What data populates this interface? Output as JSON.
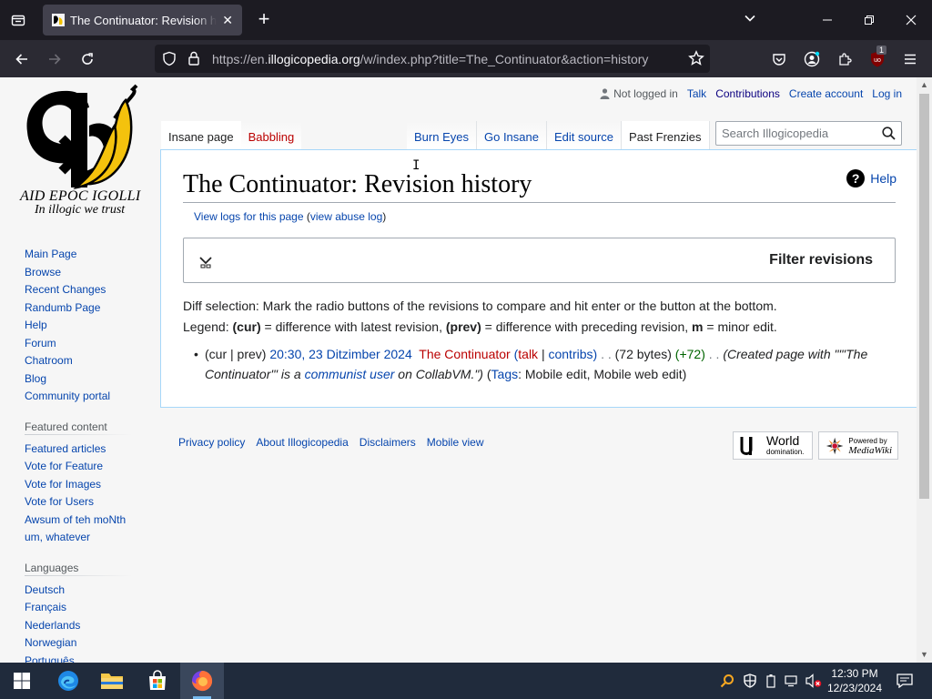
{
  "browser": {
    "tab_title": "The Continuator: Revision history",
    "url_prefix": "https://en.",
    "url_host": "illogicopedia.org",
    "url_path": "/w/index.php?title=The_Continuator&action=history",
    "extension_badge": "1"
  },
  "logo": {
    "line1": "AID EPOC IGOLLI",
    "line2": "In illogic we trust"
  },
  "personal": {
    "not_logged_in": "Not logged in",
    "talk": "Talk",
    "contributions": "Contributions",
    "create_account": "Create account",
    "log_in": "Log in"
  },
  "tabs": {
    "page": "Insane page",
    "talk": "Babbling",
    "read": "Burn Eyes",
    "edit": "Go Insane",
    "edit_source": "Edit source",
    "history": "Past Frenzies"
  },
  "search": {
    "placeholder": "Search Illogicopedia"
  },
  "sidebar": {
    "nav": [
      "Main Page",
      "Browse",
      "Recent Changes",
      "Randumb Page",
      "Help",
      "Forum",
      "Chatroom",
      "Blog",
      "Community portal"
    ],
    "featured_heading": "Featured content",
    "featured": [
      "Featured articles",
      "Vote for Feature",
      "Vote for Images",
      "Vote for Users",
      "Awsum of teh moNth",
      "um, whatever"
    ],
    "languages_heading": "Languages",
    "languages": [
      "Deutsch",
      "Français",
      "Nederlands",
      "Norwegian",
      "Português"
    ]
  },
  "content": {
    "title": "The Continuator: Revision history",
    "help": "Help",
    "view_logs": "View logs for this page",
    "view_abuse_log": "view abuse log",
    "filter_title": "Filter revisions",
    "diff_selection": "Diff selection: Mark the radio buttons of the revisions to compare and hit enter or the button at the bottom.",
    "legend_prefix": "Legend: ",
    "legend_cur": "(cur)",
    "legend_cur_desc": " = difference with latest revision, ",
    "legend_prev": "(prev)",
    "legend_prev_desc": " = difference with preceding revision, ",
    "legend_m": "m",
    "legend_m_desc": " = minor edit."
  },
  "history": {
    "cur_prev": "(cur | prev)",
    "date": "20:30, 23 Ditzimber 2024",
    "user": "The Continuator",
    "talk": "talk",
    "contribs": "contribs",
    "size": "(72 bytes)",
    "change": "(+72)",
    "summary_start": "(Created page with \"\"'The Continuator'\" is a ",
    "summary_link": "communist user",
    "summary_end": " on CollabVM.\")",
    "tags_label": "Tags",
    "tags": "Mobile edit, Mobile web edit"
  },
  "footer": {
    "links": [
      "Privacy policy",
      "About Illogicopedia",
      "Disclaimers",
      "Mobile view"
    ],
    "badge1": "World domination.",
    "badge1_main": "World",
    "badge1_sub": "domination.",
    "badge2_top": "Powered by",
    "badge2_main": "MediaWiki"
  },
  "taskbar": {
    "time": "12:30 PM",
    "date": "12/23/2024"
  }
}
